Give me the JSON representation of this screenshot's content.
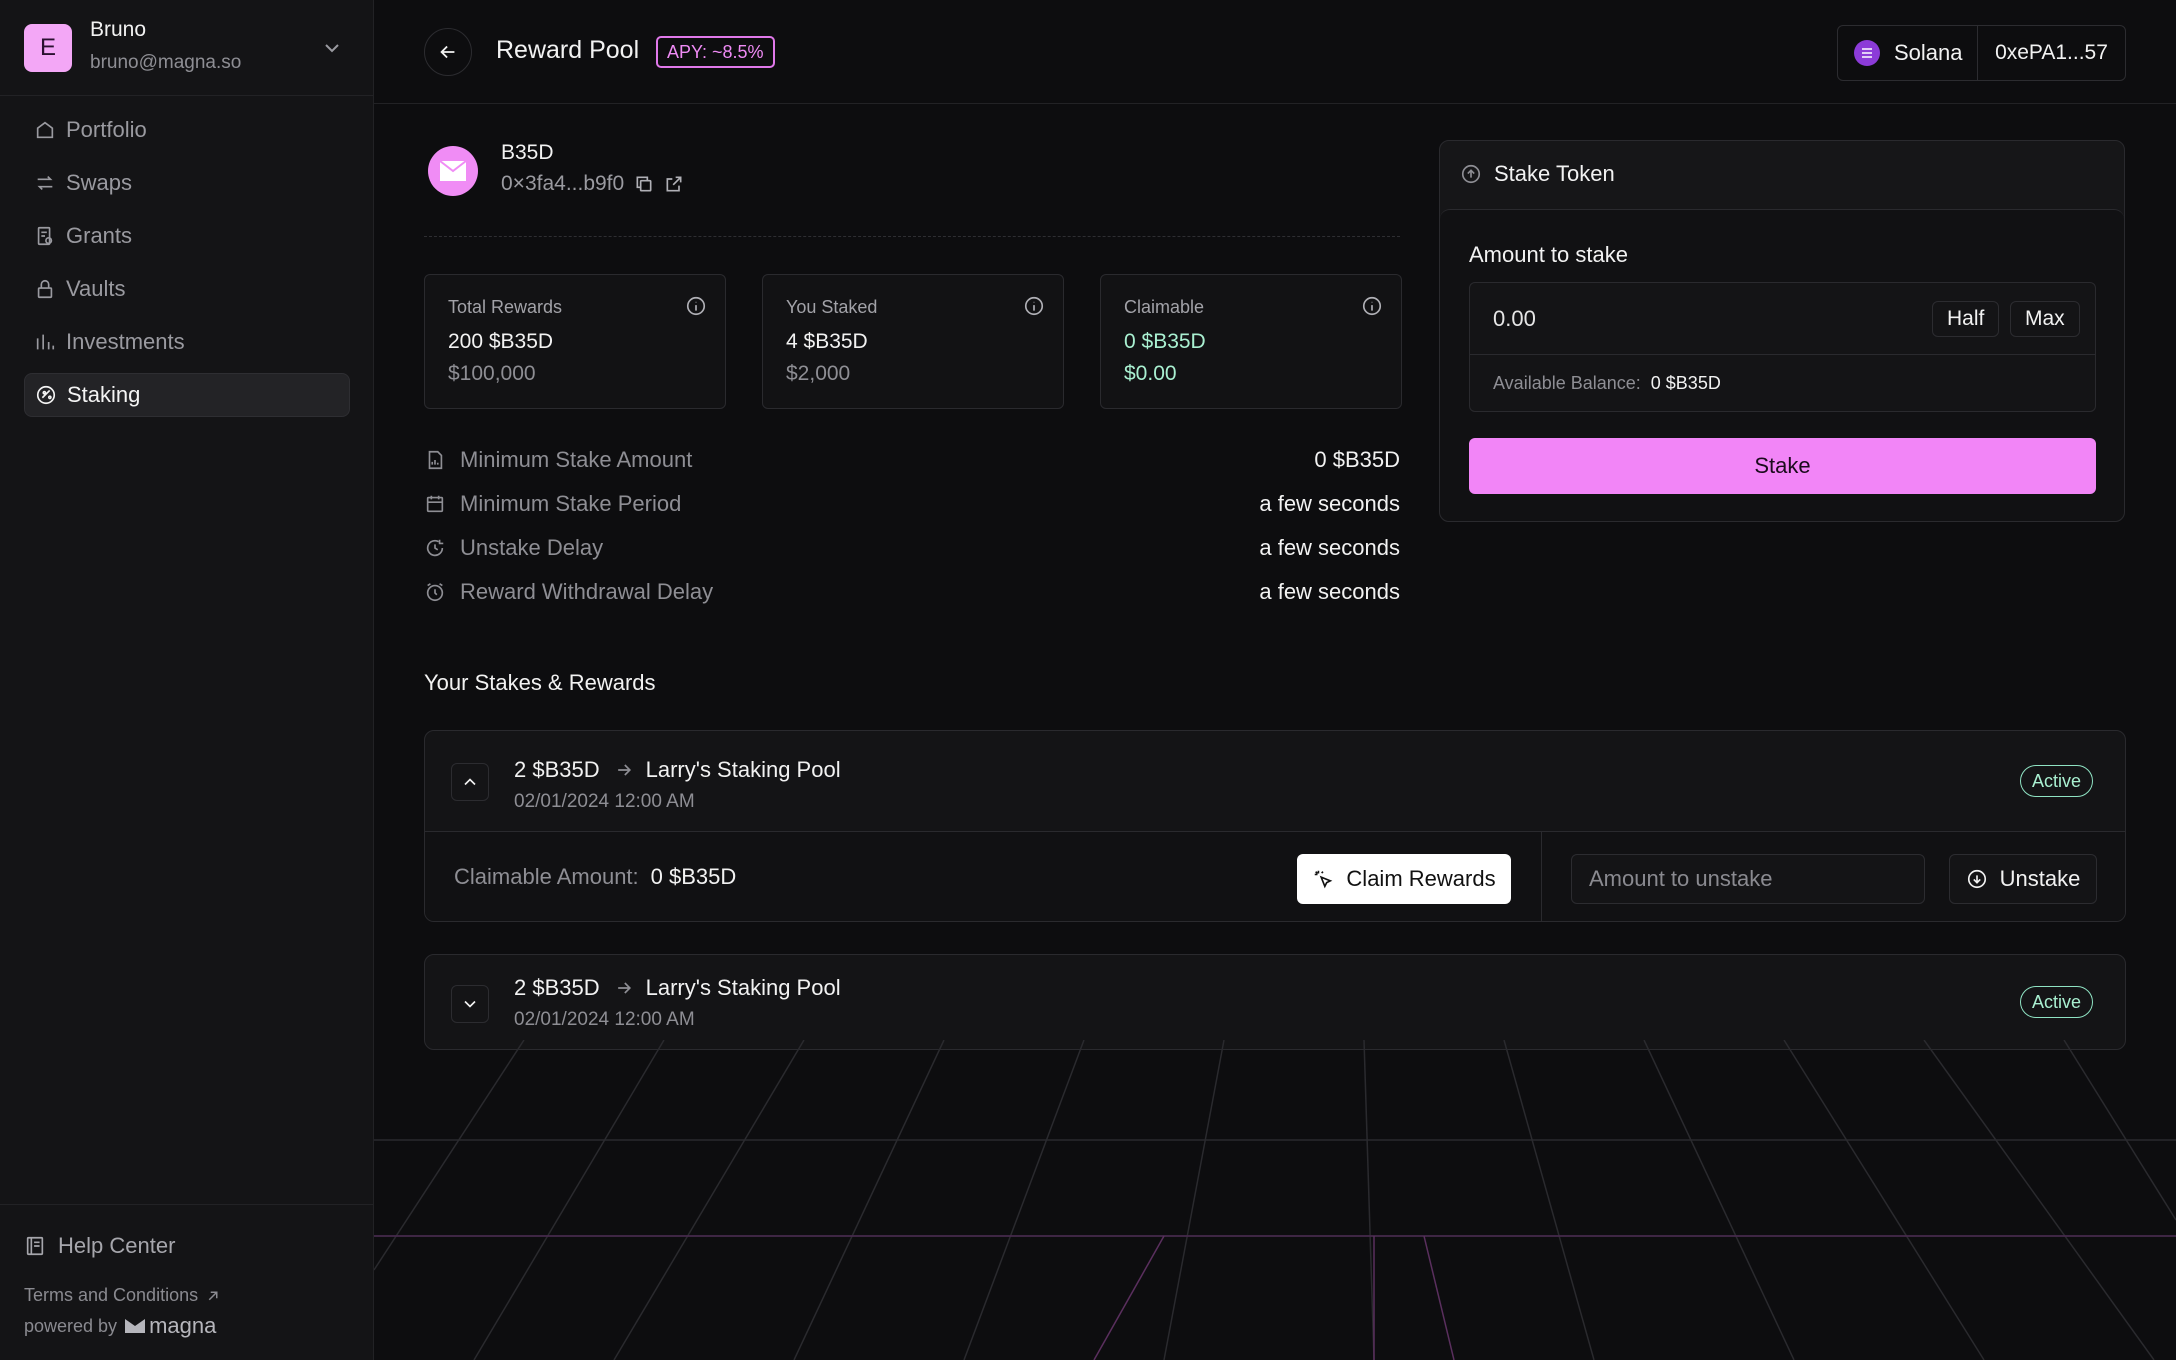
{
  "user": {
    "initial": "E",
    "name": "Bruno",
    "email": "bruno@magna.so"
  },
  "nav": [
    {
      "label": "Portfolio",
      "icon": "home-icon"
    },
    {
      "label": "Swaps",
      "icon": "swap-icon"
    },
    {
      "label": "Grants",
      "icon": "grants-icon"
    },
    {
      "label": "Vaults",
      "icon": "lock-icon"
    },
    {
      "label": "Investments",
      "icon": "bar-chart-icon"
    },
    {
      "label": "Staking",
      "icon": "staking-icon",
      "active": true
    }
  ],
  "footer": {
    "help": "Help Center",
    "terms": "Terms and Conditions",
    "powered": "powered by",
    "brand": "magna"
  },
  "header": {
    "title": "Reward Pool",
    "apy": "APY: ~8.5%",
    "chain": "Solana",
    "wallet": "0xePA1...57"
  },
  "token": {
    "name": "B35D",
    "address": "0×3fa4...b9f0"
  },
  "stats": [
    {
      "label": "Total Rewards",
      "value": "200 $B35D",
      "usd": "$100,000"
    },
    {
      "label": "You Staked",
      "value": "4 $B35D",
      "usd": "$2,000"
    },
    {
      "label": "Claimable",
      "value": "0 $B35D",
      "usd": "$0.00"
    }
  ],
  "details": [
    {
      "label": "Minimum Stake Amount",
      "value": "0 $B35D",
      "icon": "document-icon"
    },
    {
      "label": "Minimum Stake Period",
      "value": "a few seconds",
      "icon": "calendar-icon"
    },
    {
      "label": "Unstake Delay",
      "value": "a few seconds",
      "icon": "timer-icon"
    },
    {
      "label": "Reward Withdrawal Delay",
      "value": "a few seconds",
      "icon": "alarm-icon"
    }
  ],
  "stake_panel": {
    "title": "Stake Token",
    "amount_label": "Amount to stake",
    "amount_placeholder": "0.00",
    "half": "Half",
    "max": "Max",
    "available_label": "Available Balance:",
    "available_value": "0 $B35D",
    "button": "Stake"
  },
  "stakes_section": {
    "title": "Your Stakes & Rewards",
    "claim_label": "Claimable Amount:",
    "claim_button": "Claim Rewards",
    "unstake_placeholder": "Amount to unstake",
    "unstake_button": "Unstake",
    "rows": [
      {
        "amount": "2 $B35D",
        "pool": "Larry's Staking Pool",
        "date": "02/01/2024 12:00 AM",
        "status": "Active",
        "expanded": true,
        "claimable": "0 $B35D"
      },
      {
        "amount": "2 $B35D",
        "pool": "Larry's Staking Pool",
        "date": "02/01/2024 12:00 AM",
        "status": "Active",
        "expanded": false
      }
    ]
  },
  "colors": {
    "accent": "#f285f7",
    "success": "#a9f0d1",
    "background": "#0d0d0f",
    "sidebar": "#141416"
  }
}
